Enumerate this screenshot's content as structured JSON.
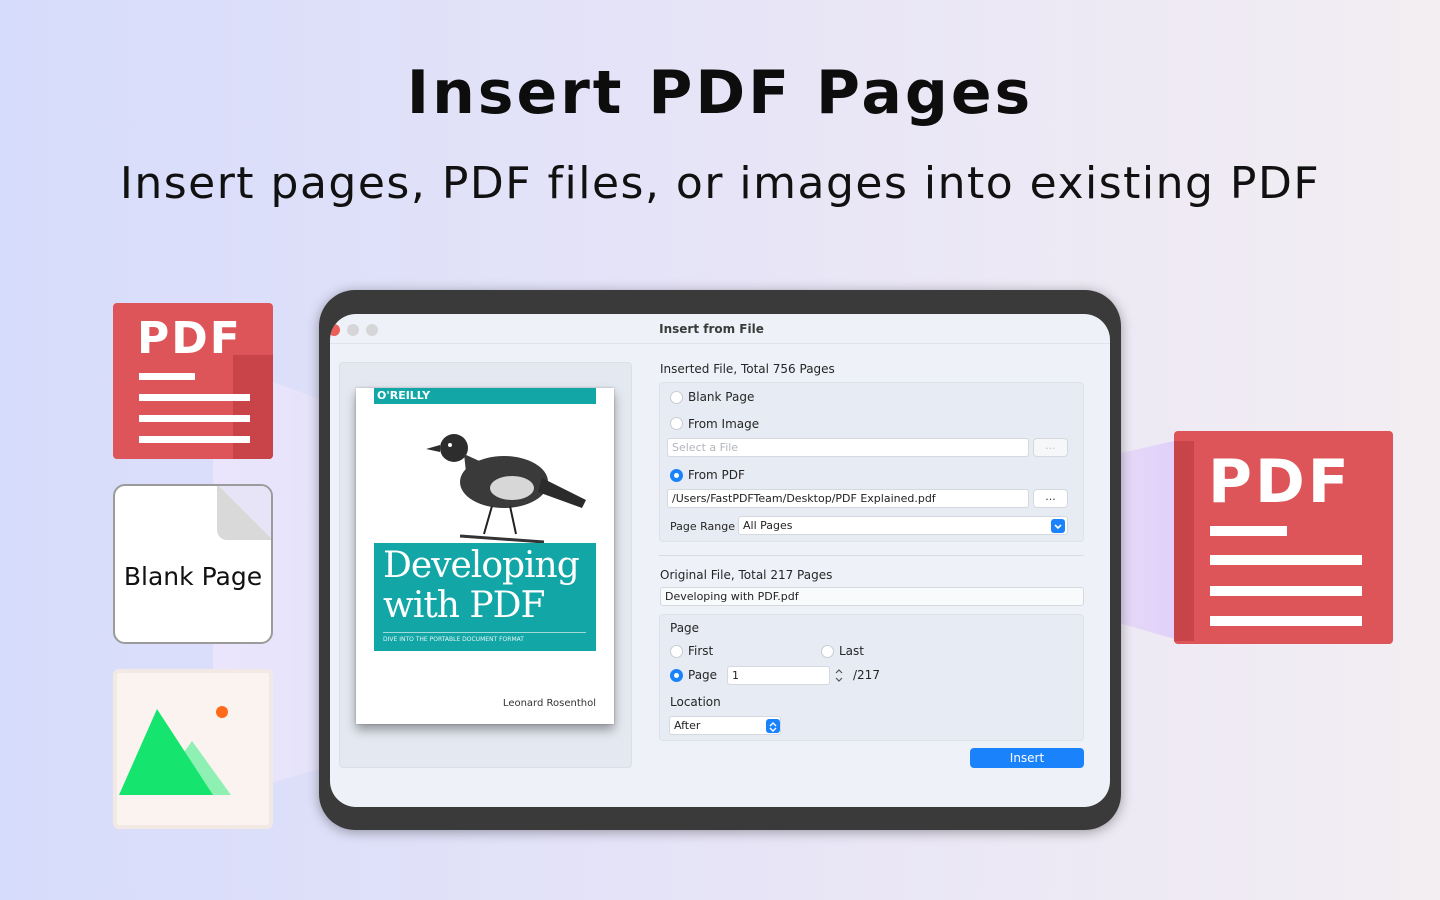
{
  "hero": {
    "title": "Insert PDF Pages",
    "subtitle": "Insert pages, PDF files, or images into existing PDF"
  },
  "side_icons": {
    "pdf_small_label": "PDF",
    "blank_page_label": "Blank Page",
    "pdf_large_label": "PDF"
  },
  "window": {
    "title": "Insert from File"
  },
  "preview": {
    "publisher": "O'REILLY",
    "book_title_line1": "Developing",
    "book_title_line2": "with PDF",
    "book_tagline": "DIVE INTO THE PORTABLE DOCUMENT FORMAT",
    "author": "Leonard Rosenthol"
  },
  "inserted_file": {
    "heading": "Inserted File, Total 756 Pages",
    "option_blank": "Blank Page",
    "option_image": "From Image",
    "image_placeholder": "Select a File",
    "browse_label": "...",
    "option_pdf": "From PDF",
    "pdf_path": "/Users/FastPDFTeam/Desktop/PDF Explained.pdf",
    "page_range_label": "Page Range",
    "page_range_value": "All Pages",
    "selected_option": "From PDF"
  },
  "original_file": {
    "heading": "Original File, Total 217 Pages",
    "file_name": "Developing with PDF.pdf",
    "page_section_label": "Page",
    "option_first": "First",
    "option_last": "Last",
    "option_page": "Page",
    "page_value": "1",
    "page_total": "/217",
    "location_label": "Location",
    "location_value": "After",
    "selected_option": "Page"
  },
  "actions": {
    "insert_label": "Insert"
  },
  "colors": {
    "accent": "#1a82fb",
    "pdf_red": "#dd5558",
    "book_teal": "#12a6a6",
    "image_green": "#15e56e"
  }
}
